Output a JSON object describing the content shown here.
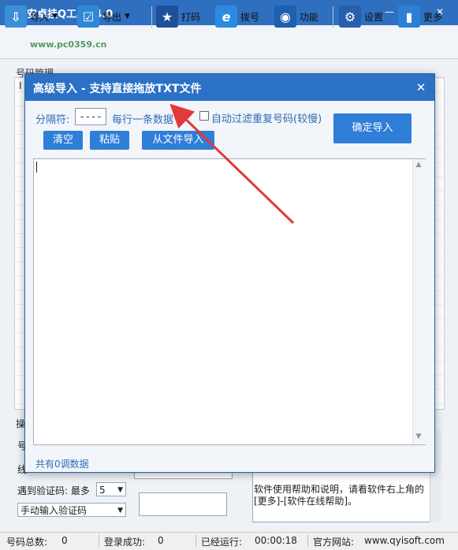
{
  "window": {
    "title": "奇易安卓挂Q工具V4.0",
    "minimize": "—",
    "maximize": "☐",
    "close": "✕"
  },
  "watermark": "www.pc0359.cn",
  "toolbar": {
    "items": [
      {
        "label": "导入",
        "icon": "import-icon"
      },
      {
        "label": "导出",
        "icon": "export-icon"
      },
      {
        "label": "打码",
        "icon": "star-icon"
      },
      {
        "label": "拨号",
        "icon": "ie-dial-icon"
      },
      {
        "label": "功能",
        "icon": "disc-icon"
      },
      {
        "label": "设置",
        "icon": "gear-icon"
      },
      {
        "label": "更多",
        "icon": "chart-icon"
      }
    ]
  },
  "main": {
    "list_group_label": "号码管理",
    "list_header_first": "I",
    "left_label_1": "操",
    "left_label_2": "号",
    "left_label_3": "线",
    "captcha_label": "遇到验证码: 最多",
    "captcha_max": "5",
    "captcha_mode": "手动输入验证码",
    "help_text": "软件使用帮助和说明，请看软件右上角的[更多]-[软件在线帮助]。"
  },
  "status": {
    "total_label": "号码总数:",
    "total_value": "0",
    "success_label": "登录成功:",
    "success_value": "0",
    "running_label": "已经运行:",
    "running_value": "00:00:18",
    "site_label": "官方网站:",
    "site_value": "www.qyisoft.com"
  },
  "dialog": {
    "title": "高级导入 - 支持直接拖放TXT文件",
    "close": "✕",
    "separator_label": "分隔符:",
    "separator_value": "----",
    "per_line_label": "每行一条数据",
    "dedup_label": "自动过滤重复号码(较慢)",
    "dedup_checked": false,
    "confirm_button": "确定导入",
    "clear_button": "清空",
    "paste_button": "粘贴",
    "from_file_button": "从文件导入",
    "text_content": "",
    "count_text": "共有0调数据"
  },
  "colors": {
    "title_bar": "#2f6fbf",
    "dialog_title": "#2b72c6",
    "button_blue": "#2f7ed8",
    "label_blue": "#2d6cb5",
    "arrow_red": "#e03a3a"
  }
}
